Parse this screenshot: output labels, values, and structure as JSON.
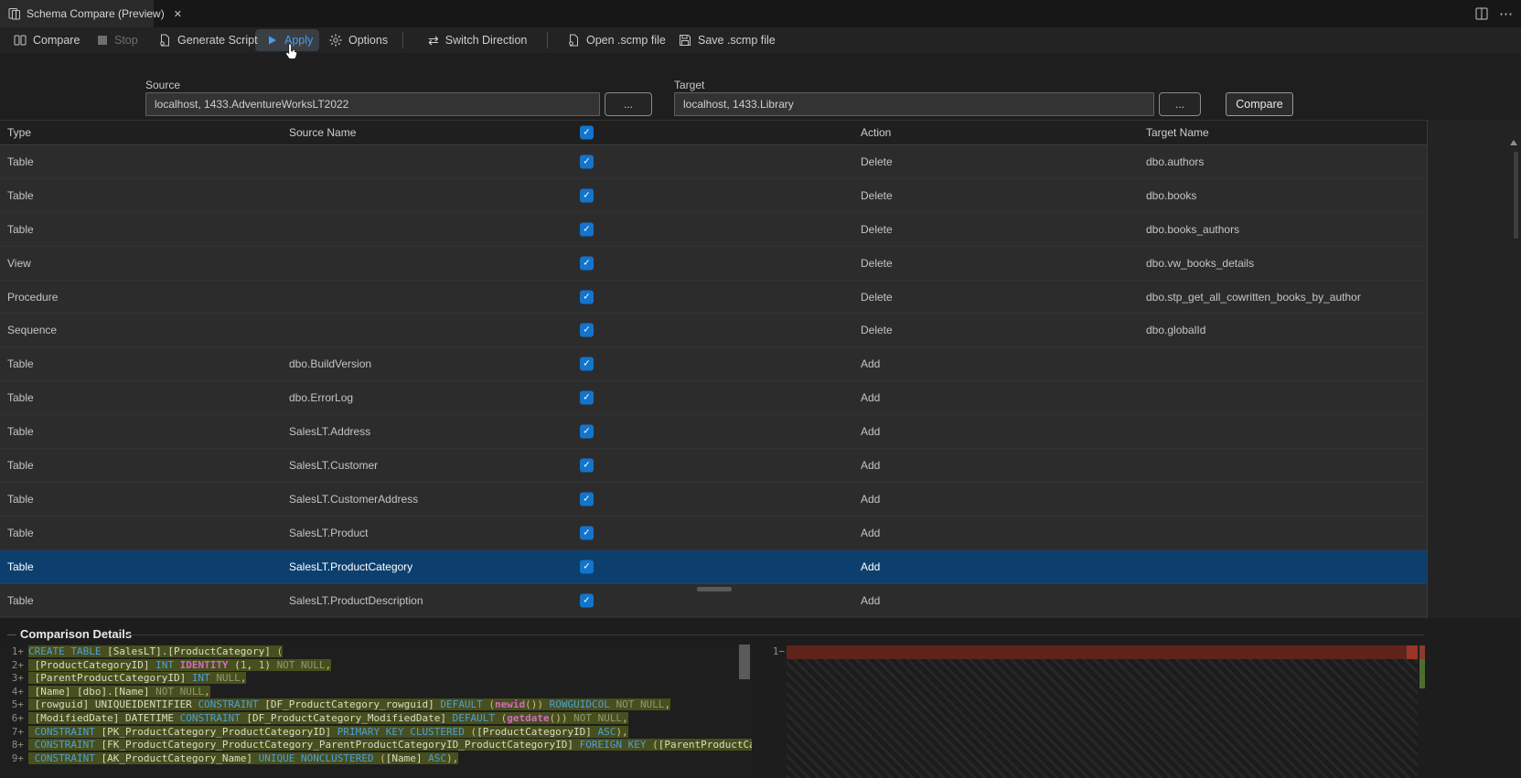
{
  "window": {
    "tab_title": "Schema Compare (Preview)",
    "close_label": "✕",
    "more_actions": "⋯"
  },
  "toolbar": {
    "compare": "Compare",
    "stop": "Stop",
    "generate_script": "Generate Script",
    "apply": "Apply",
    "options": "Options",
    "switch_direction": "Switch Direction",
    "open_scmp": "Open .scmp file",
    "save_scmp": "Save .scmp file"
  },
  "connections": {
    "source_label": "Source",
    "source_value": "localhost, 1433.AdventureWorksLT2022",
    "target_label": "Target",
    "target_value": "localhost, 1433.Library",
    "browse_label": "...",
    "compare_button": "Compare"
  },
  "grid": {
    "columns": {
      "type": "Type",
      "source_name": "Source Name",
      "action": "Action",
      "target_name": "Target Name"
    },
    "header_checkbox_checked": true,
    "rows": [
      {
        "type": "Table",
        "source": "",
        "action": "Delete",
        "target": "dbo.authors",
        "checked": true,
        "selected": false
      },
      {
        "type": "Table",
        "source": "",
        "action": "Delete",
        "target": "dbo.books",
        "checked": true,
        "selected": false
      },
      {
        "type": "Table",
        "source": "",
        "action": "Delete",
        "target": "dbo.books_authors",
        "checked": true,
        "selected": false
      },
      {
        "type": "View",
        "source": "",
        "action": "Delete",
        "target": "dbo.vw_books_details",
        "checked": true,
        "selected": false
      },
      {
        "type": "Procedure",
        "source": "",
        "action": "Delete",
        "target": "dbo.stp_get_all_cowritten_books_by_author",
        "checked": true,
        "selected": false
      },
      {
        "type": "Sequence",
        "source": "",
        "action": "Delete",
        "target": "dbo.globalId",
        "checked": true,
        "selected": false
      },
      {
        "type": "Table",
        "source": "dbo.BuildVersion",
        "action": "Add",
        "target": "",
        "checked": true,
        "selected": false
      },
      {
        "type": "Table",
        "source": "dbo.ErrorLog",
        "action": "Add",
        "target": "",
        "checked": true,
        "selected": false
      },
      {
        "type": "Table",
        "source": "SalesLT.Address",
        "action": "Add",
        "target": "",
        "checked": true,
        "selected": false
      },
      {
        "type": "Table",
        "source": "SalesLT.Customer",
        "action": "Add",
        "target": "",
        "checked": true,
        "selected": false
      },
      {
        "type": "Table",
        "source": "SalesLT.CustomerAddress",
        "action": "Add",
        "target": "",
        "checked": true,
        "selected": false
      },
      {
        "type": "Table",
        "source": "SalesLT.Product",
        "action": "Add",
        "target": "",
        "checked": true,
        "selected": false
      },
      {
        "type": "Table",
        "source": "SalesLT.ProductCategory",
        "action": "Add",
        "target": "",
        "checked": true,
        "selected": true
      },
      {
        "type": "Table",
        "source": "SalesLT.ProductDescription",
        "action": "Add",
        "target": "",
        "checked": true,
        "selected": false
      }
    ]
  },
  "details": {
    "title": "Comparison Details",
    "left_lines": [
      {
        "no": "1",
        "sign": "+",
        "tokens": [
          [
            "kw",
            "CREATE TABLE"
          ],
          [
            "id",
            " [SalesLT].[ProductCategory] "
          ],
          [
            "br",
            "("
          ]
        ]
      },
      {
        "no": "2",
        "sign": "+",
        "tokens": [
          [
            "id",
            " [ProductCategoryID] "
          ],
          [
            "kw",
            "INT"
          ],
          [
            "id",
            " "
          ],
          [
            "fn",
            "IDENTITY"
          ],
          [
            "id",
            " ("
          ],
          [
            "num",
            "1"
          ],
          [
            "id",
            ", "
          ],
          [
            "num",
            "1"
          ],
          [
            "id",
            ") "
          ],
          [
            "gr",
            "NOT NULL"
          ],
          [
            "br",
            ","
          ]
        ]
      },
      {
        "no": "3",
        "sign": "+",
        "tokens": [
          [
            "id",
            " [ParentProductCategoryID] "
          ],
          [
            "kw",
            "INT"
          ],
          [
            "id",
            " "
          ],
          [
            "gr",
            "NULL"
          ],
          [
            "br",
            ","
          ]
        ]
      },
      {
        "no": "4",
        "sign": "+",
        "tokens": [
          [
            "id",
            " [Name] [dbo].[Name] "
          ],
          [
            "gr",
            "NOT NULL"
          ],
          [
            "br",
            ","
          ]
        ]
      },
      {
        "no": "5",
        "sign": "+",
        "tokens": [
          [
            "id",
            " [rowguid] UNIQUEIDENTIFIER "
          ],
          [
            "kw",
            "CONSTRAINT"
          ],
          [
            "id",
            " [DF_ProductCategory_rowguid] "
          ],
          [
            "kw",
            "DEFAULT"
          ],
          [
            "id",
            " "
          ],
          [
            "br",
            "("
          ],
          [
            "fn",
            "newid"
          ],
          [
            "br",
            "())"
          ],
          [
            "id",
            " "
          ],
          [
            "kw",
            "ROWGUIDCOL"
          ],
          [
            "id",
            " "
          ],
          [
            "gr",
            "NOT NULL"
          ],
          [
            "br",
            ","
          ]
        ]
      },
      {
        "no": "6",
        "sign": "+",
        "tokens": [
          [
            "id",
            " [ModifiedDate] DATETIME "
          ],
          [
            "kw",
            "CONSTRAINT"
          ],
          [
            "id",
            " [DF_ProductCategory_ModifiedDate] "
          ],
          [
            "kw",
            "DEFAULT"
          ],
          [
            "id",
            " "
          ],
          [
            "br",
            "("
          ],
          [
            "fn",
            "getdate"
          ],
          [
            "br",
            "())"
          ],
          [
            "id",
            " "
          ],
          [
            "gr",
            "NOT NULL"
          ],
          [
            "br",
            ","
          ]
        ]
      },
      {
        "no": "7",
        "sign": "+",
        "tokens": [
          [
            "id",
            " "
          ],
          [
            "kw",
            "CONSTRAINT"
          ],
          [
            "id",
            " [PK_ProductCategory_ProductCategoryID] "
          ],
          [
            "kw",
            "PRIMARY KEY CLUSTERED"
          ],
          [
            "id",
            " "
          ],
          [
            "br",
            "("
          ],
          [
            "id",
            "[ProductCategoryID] "
          ],
          [
            "kw",
            "ASC"
          ],
          [
            "br",
            "),"
          ]
        ]
      },
      {
        "no": "8",
        "sign": "+",
        "tokens": [
          [
            "id",
            " "
          ],
          [
            "kw",
            "CONSTRAINT"
          ],
          [
            "id",
            " [FK_ProductCategory_ProductCategory_ParentProductCategoryID_ProductCategoryID] "
          ],
          [
            "kw",
            "FOREIGN KEY"
          ],
          [
            "id",
            " "
          ],
          [
            "br",
            "("
          ],
          [
            "id",
            "[ParentProductCategoryID]"
          ]
        ]
      },
      {
        "no": "9",
        "sign": "+",
        "tokens": [
          [
            "id",
            " "
          ],
          [
            "kw",
            "CONSTRAINT"
          ],
          [
            "id",
            " [AK_ProductCategory_Name] "
          ],
          [
            "kw",
            "UNIQUE NONCLUSTERED"
          ],
          [
            "id",
            " "
          ],
          [
            "br",
            "("
          ],
          [
            "id",
            "[Name] "
          ],
          [
            "kw",
            "ASC"
          ],
          [
            "br",
            "),"
          ]
        ]
      }
    ],
    "right_line_no": "1",
    "right_sign": "−"
  },
  "colors": {
    "accent_blue": "#459df5",
    "checkbox_blue": "#1374cc",
    "selected_row": "#0d3f6e",
    "diff_added_bg": "#474f1e",
    "diff_removed_bar": "#5f231c"
  }
}
